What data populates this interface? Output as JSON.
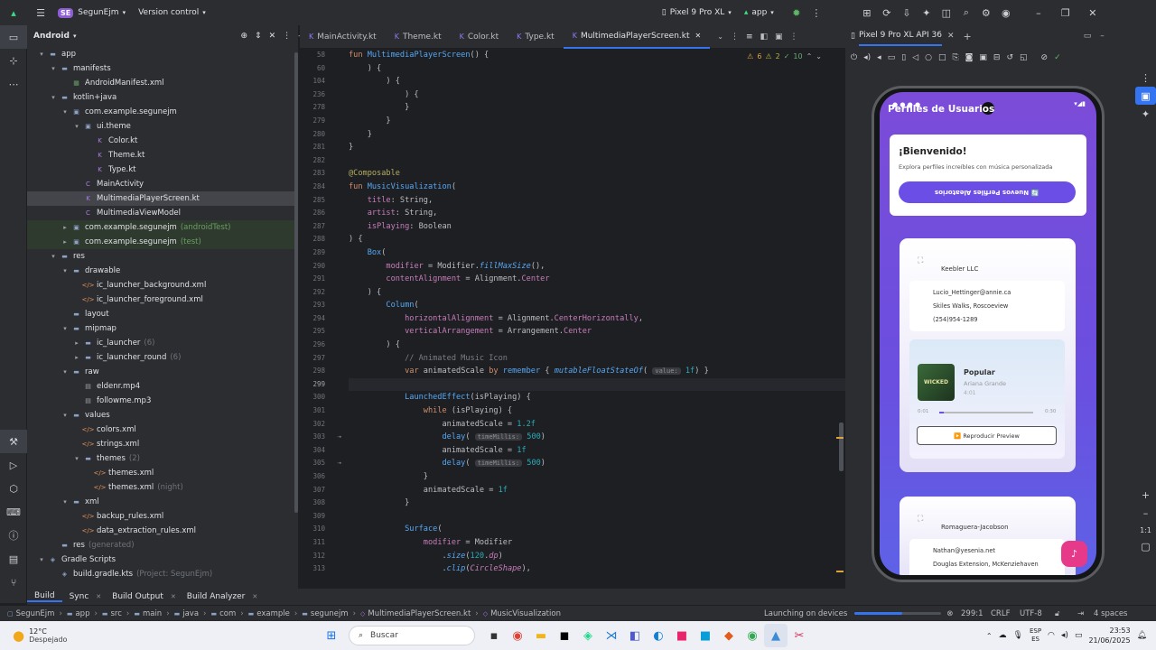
{
  "topbar": {
    "project_badge": "SE",
    "project_name": "SegunEjm",
    "vcs": "Version control",
    "device": "Pixel 9 Pro XL",
    "run_config": "app"
  },
  "project_panel": {
    "view": "Android",
    "tree": [
      {
        "label": "app",
        "indent": 0,
        "arrow": "▾",
        "icon": "folder",
        "extra": ""
      },
      {
        "label": "manifests",
        "indent": 1,
        "arrow": "▾",
        "icon": "folder",
        "extra": ""
      },
      {
        "label": "AndroidManifest.xml",
        "indent": 2,
        "arrow": "",
        "icon": "manifest",
        "extra": ""
      },
      {
        "label": "kotlin+java",
        "indent": 1,
        "arrow": "▾",
        "icon": "folder",
        "extra": ""
      },
      {
        "label": "com.example.segunejm",
        "indent": 2,
        "arrow": "▾",
        "icon": "package",
        "extra": ""
      },
      {
        "label": "ui.theme",
        "indent": 3,
        "arrow": "▾",
        "icon": "package",
        "extra": ""
      },
      {
        "label": "Color.kt",
        "indent": 4,
        "arrow": "",
        "icon": "kt",
        "extra": ""
      },
      {
        "label": "Theme.kt",
        "indent": 4,
        "arrow": "",
        "icon": "kt",
        "extra": ""
      },
      {
        "label": "Type.kt",
        "indent": 4,
        "arrow": "",
        "icon": "kt",
        "extra": ""
      },
      {
        "label": "MainActivity",
        "indent": 3,
        "arrow": "",
        "icon": "class",
        "extra": ""
      },
      {
        "label": "MultimediaPlayerScreen.kt",
        "indent": 3,
        "arrow": "",
        "icon": "kt",
        "extra": "",
        "selected": true
      },
      {
        "label": "MultimediaViewModel",
        "indent": 3,
        "arrow": "",
        "icon": "class",
        "extra": ""
      },
      {
        "label": "com.example.segunejm",
        "indent": 2,
        "arrow": "▸",
        "icon": "package",
        "extra": "(androidTest)",
        "highlight": true
      },
      {
        "label": "com.example.segunejm",
        "indent": 2,
        "arrow": "▸",
        "icon": "package",
        "extra": "(test)",
        "highlight": true
      },
      {
        "label": "res",
        "indent": 1,
        "arrow": "▾",
        "icon": "folder",
        "extra": ""
      },
      {
        "label": "drawable",
        "indent": 2,
        "arrow": "▾",
        "icon": "folder",
        "extra": ""
      },
      {
        "label": "ic_launcher_background.xml",
        "indent": 3,
        "arrow": "",
        "icon": "xml",
        "extra": ""
      },
      {
        "label": "ic_launcher_foreground.xml",
        "indent": 3,
        "arrow": "",
        "icon": "xml",
        "extra": ""
      },
      {
        "label": "layout",
        "indent": 2,
        "arrow": "",
        "icon": "folder",
        "extra": ""
      },
      {
        "label": "mipmap",
        "indent": 2,
        "arrow": "▾",
        "icon": "folder",
        "extra": ""
      },
      {
        "label": "ic_launcher",
        "indent": 3,
        "arrow": "▸",
        "icon": "folder",
        "extra": "(6)"
      },
      {
        "label": "ic_launcher_round",
        "indent": 3,
        "arrow": "▸",
        "icon": "folder",
        "extra": "(6)"
      },
      {
        "label": "raw",
        "indent": 2,
        "arrow": "▾",
        "icon": "folder",
        "extra": ""
      },
      {
        "label": "eldenr.mp4",
        "indent": 3,
        "arrow": "",
        "icon": "media",
        "extra": ""
      },
      {
        "label": "followme.mp3",
        "indent": 3,
        "arrow": "",
        "icon": "media",
        "extra": ""
      },
      {
        "label": "values",
        "indent": 2,
        "arrow": "▾",
        "icon": "folder",
        "extra": ""
      },
      {
        "label": "colors.xml",
        "indent": 3,
        "arrow": "",
        "icon": "xml",
        "extra": ""
      },
      {
        "label": "strings.xml",
        "indent": 3,
        "arrow": "",
        "icon": "xml",
        "extra": ""
      },
      {
        "label": "themes",
        "indent": 3,
        "arrow": "▾",
        "icon": "folder",
        "extra": "(2)"
      },
      {
        "label": "themes.xml",
        "indent": 4,
        "arrow": "",
        "icon": "xml",
        "extra": ""
      },
      {
        "label": "themes.xml",
        "indent": 4,
        "arrow": "",
        "icon": "xml",
        "extra": "(night)"
      },
      {
        "label": "xml",
        "indent": 2,
        "arrow": "▾",
        "icon": "folder",
        "extra": ""
      },
      {
        "label": "backup_rules.xml",
        "indent": 3,
        "arrow": "",
        "icon": "xml",
        "extra": ""
      },
      {
        "label": "data_extraction_rules.xml",
        "indent": 3,
        "arrow": "",
        "icon": "xml",
        "extra": ""
      },
      {
        "label": "res",
        "indent": 1,
        "arrow": "",
        "icon": "folder",
        "extra": "(generated)"
      },
      {
        "label": "Gradle Scripts",
        "indent": 0,
        "arrow": "▾",
        "icon": "gradle",
        "extra": ""
      },
      {
        "label": "build.gradle.kts",
        "indent": 1,
        "arrow": "",
        "icon": "gradle",
        "extra": "(Project: SegunEjm)"
      }
    ]
  },
  "editor_tabs": [
    "MainActivity.kt",
    "Theme.kt",
    "Color.kt",
    "Type.kt",
    "MultimediaPlayerScreen.kt"
  ],
  "inspections": {
    "warnings": "6",
    "weak": "2",
    "typos": "10"
  },
  "code_lines": [
    {
      "n": "58",
      "html": "<span class=\"kw\">fun </span><span class=\"fn\">MultimediaPlayerScreen</span>() {"
    },
    {
      "n": "60",
      "html": "    ) {"
    },
    {
      "n": "104",
      "html": "        ) {"
    },
    {
      "n": "236",
      "html": "            ) {"
    },
    {
      "n": "278",
      "html": "            }"
    },
    {
      "n": "279",
      "html": "        }"
    },
    {
      "n": "280",
      "html": "    }"
    },
    {
      "n": "281",
      "html": "}"
    },
    {
      "n": "282",
      "html": ""
    },
    {
      "n": "283",
      "html": "<span class=\"an\">@Composable</span>"
    },
    {
      "n": "284",
      "html": "<span class=\"kw\">fun </span><span class=\"fn\">MusicVisualization</span>("
    },
    {
      "n": "285",
      "html": "    <span class=\"pm\">title</span>: String,"
    },
    {
      "n": "286",
      "html": "    <span class=\"pm\">artist</span>: String,"
    },
    {
      "n": "287",
      "html": "    <span class=\"pm\">isPlaying</span>: Boolean"
    },
    {
      "n": "288",
      "html": ") {"
    },
    {
      "n": "289",
      "html": "    <span class=\"fn\">Box</span>("
    },
    {
      "n": "290",
      "html": "        <span class=\"pm\">modifier</span> = Modifier.<span class=\"fn it\">fillMaxSize</span>(),"
    },
    {
      "n": "291",
      "html": "        <span class=\"pm\">contentAlignment</span> = Alignment.<span class=\"prop\">Center</span>"
    },
    {
      "n": "292",
      "html": "    ) {"
    },
    {
      "n": "293",
      "html": "        <span class=\"fn\">Column</span>("
    },
    {
      "n": "294",
      "html": "            <span class=\"pm\">horizontalAlignment</span> = Alignment.<span class=\"prop\">CenterHorizontally</span>,"
    },
    {
      "n": "295",
      "html": "            <span class=\"pm\">verticalArrangement</span> = Arrangement.<span class=\"prop\">Center</span>"
    },
    {
      "n": "296",
      "html": "        ) {"
    },
    {
      "n": "297",
      "html": "            <span class=\"cm\">// Animated Music Icon</span>"
    },
    {
      "n": "298",
      "html": "            <span class=\"kw\">var </span>animatedScale <span class=\"kw\">by </span><span class=\"fn\">remember</span> { <span class=\"fn it\">mutableFloatStateOf</span>( <span class=\"hint\">value:</span> <span class=\"nm\">1f</span>) }"
    },
    {
      "n": "299",
      "html": "",
      "cur": true
    },
    {
      "n": "300",
      "html": "            <span class=\"fn\">LaunchedEffect</span>(isPlaying) {"
    },
    {
      "n": "301",
      "html": "                <span class=\"kw\">while </span>(isPlaying) {"
    },
    {
      "n": "302",
      "html": "                    animatedScale = <span class=\"nm\">1.2f</span>"
    },
    {
      "n": "303",
      "html": "                    <span class=\"fn\">delay</span>( <span class=\"hint\">timeMillis:</span> <span class=\"nm\">500</span>)"
    },
    {
      "n": "304",
      "html": "                    animatedScale = <span class=\"nm\">1f</span>"
    },
    {
      "n": "305",
      "html": "                    <span class=\"fn\">delay</span>( <span class=\"hint\">timeMillis:</span> <span class=\"nm\">500</span>)"
    },
    {
      "n": "306",
      "html": "                }"
    },
    {
      "n": "307",
      "html": "                animatedScale = <span class=\"nm\">1f</span>"
    },
    {
      "n": "308",
      "html": "            }"
    },
    {
      "n": "309",
      "html": ""
    },
    {
      "n": "310",
      "html": "            <span class=\"fn\">Surface</span>("
    },
    {
      "n": "311",
      "html": "                <span class=\"pm\">modifier</span> = Modifier"
    },
    {
      "n": "312",
      "html": "                    .<span class=\"fn it\">size</span>(<span class=\"nm\">120</span>.<span class=\"prop it\">dp</span>)"
    },
    {
      "n": "313",
      "html": "                    .<span class=\"fn it\">clip</span>(<span class=\"prop it\">CircleShape</span>),"
    }
  ],
  "emulator": {
    "tab": "Pixel 9 Pro XL API 36",
    "app_title": "Perfiles de Usuarios",
    "welcome": "¡Bienvenido!",
    "welcome_sub": "Explora perfiles increíbles con música personalizada",
    "new_profiles_btn": "🔄 Nuevos Perfiles Aleatorios",
    "profile1": {
      "company": "Keebler LLC",
      "email": "Lucio_Hettinger@annie.ca",
      "address": "Skiles Walks, Roscoeview",
      "phone": "(254)954-1289"
    },
    "player": {
      "title": "Popular",
      "artist": "Ariana Grande",
      "duration": "4:01",
      "time_start": "0:01",
      "time_end": "0:30",
      "preview_btn": "▶️ Reproducir Preview",
      "cover_text": "WICKED",
      "progress": 0.05
    },
    "profile2": {
      "company": "Romaguera-Jacobson",
      "email": "Nathan@yesenia.net",
      "address": "Douglas Extension, McKenziehaven"
    },
    "fab_icon": "music-note-icon"
  },
  "bottom_tabs": [
    "Build",
    "Sync",
    "Build Output",
    "Build Analyzer"
  ],
  "statusbar": {
    "breadcrumbs": [
      "SegunEjm",
      "app",
      "src",
      "main",
      "java",
      "com",
      "example",
      "segunejm",
      "MultimediaPlayerScreen.kt",
      "MusicVisualization"
    ],
    "task": "Launching on devices",
    "position": "299:1",
    "line_sep": "CRLF",
    "encoding": "UTF-8",
    "indent": "4 spaces"
  },
  "taskbar": {
    "temp": "12°C",
    "weather": "Despejado",
    "search_placeholder": "Buscar",
    "lang": "ESP",
    "lang2": "ES",
    "time": "23:53",
    "date": "21/06/2025"
  }
}
